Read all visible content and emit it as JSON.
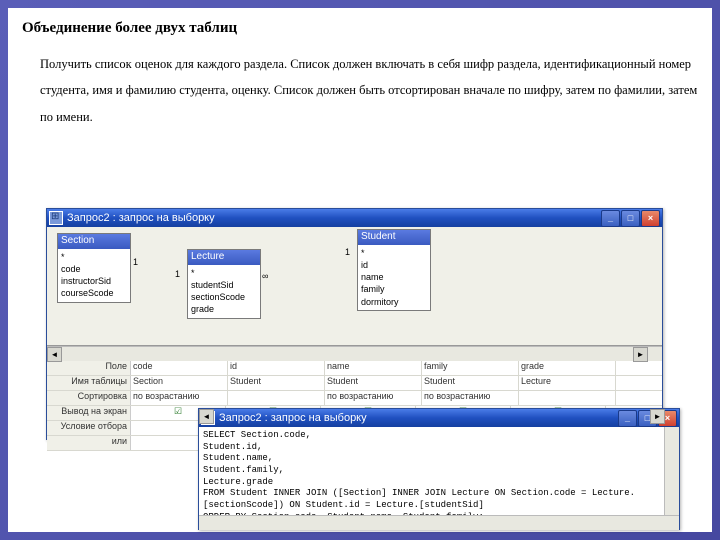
{
  "heading": "Объединение более двух таблиц",
  "para": "Получить список оценок для каждого раздела. Список должен включать в себя шифр раздела, идентификационный номер студента, имя и фамилию студента, оценку. Список должен быть отсортирован вначале по шифру, затем по фамилии, затем по имени.",
  "win1": {
    "title": "Запрос2 : запрос на выборку",
    "tables": {
      "section": {
        "name": "Section",
        "fields": [
          "*",
          "code",
          "instructorSid",
          "courseScode"
        ]
      },
      "lecture": {
        "name": "Lecture",
        "fields": [
          "*",
          "studentSid",
          "sectionScode",
          "grade"
        ]
      },
      "student": {
        "name": "Student",
        "fields": [
          "*",
          "id",
          "name",
          "family",
          "dormitory"
        ]
      }
    },
    "gridLabels": {
      "l1": "Поле",
      "l2": "Имя таблицы",
      "l3": "Сортировка",
      "l4": "Вывод на экран",
      "l5": "Условие отбора",
      "l6": "или"
    },
    "cols": [
      {
        "f": "code",
        "t": "Section",
        "s": "по возрастанию",
        "c": true
      },
      {
        "f": "id",
        "t": "Student",
        "s": "",
        "c": true
      },
      {
        "f": "name",
        "t": "Student",
        "s": "по возрастанию",
        "c": true
      },
      {
        "f": "family",
        "t": "Student",
        "s": "по возрастанию",
        "c": true
      },
      {
        "f": "grade",
        "t": "Lecture",
        "s": "",
        "c": true
      }
    ]
  },
  "win2": {
    "title": "Запрос2 : запрос на выборку",
    "sql": [
      "SELECT Section.code,",
      "Student.id,",
      "Student.name,",
      "Student.family,",
      "Lecture.grade",
      "FROM Student INNER JOIN ([Section] INNER JOIN Lecture ON Section.code = Lecture.[sectionScode]) ON Student.id = Lecture.[studentSid]",
      "ORDER BY Section.code, Student.name, Student.family;"
    ]
  }
}
